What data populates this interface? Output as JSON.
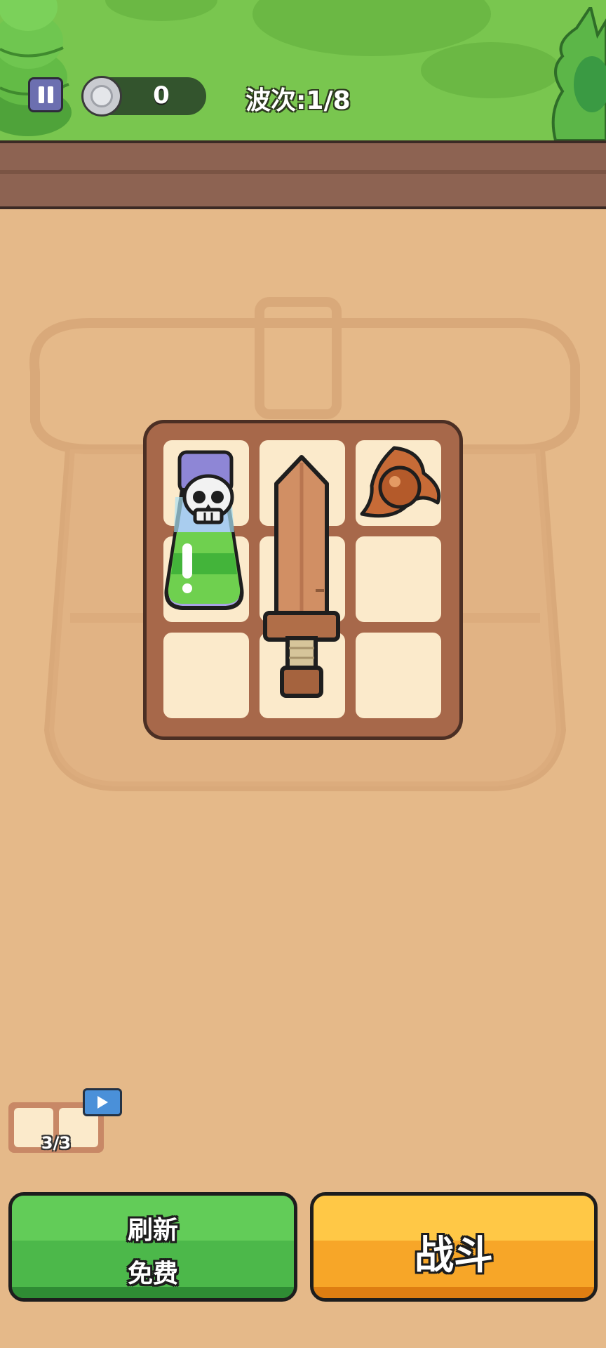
{
  "hud": {
    "coins": "0",
    "wave_label": "波次:1/8"
  },
  "backpack": {
    "items": [
      {
        "name": "poison-potion-icon"
      },
      {
        "name": "wooden-sword-icon"
      },
      {
        "name": "shuriken-icon"
      }
    ]
  },
  "bench": {
    "count": "3/3"
  },
  "buttons": {
    "refresh_line1": "刷新",
    "refresh_line2": "免费",
    "fight_label": "战斗"
  },
  "colors": {
    "grass": "#79c64f",
    "sand": "#e5b989",
    "refresh_green": "#4cb84a",
    "fight_orange": "#f7a628"
  }
}
